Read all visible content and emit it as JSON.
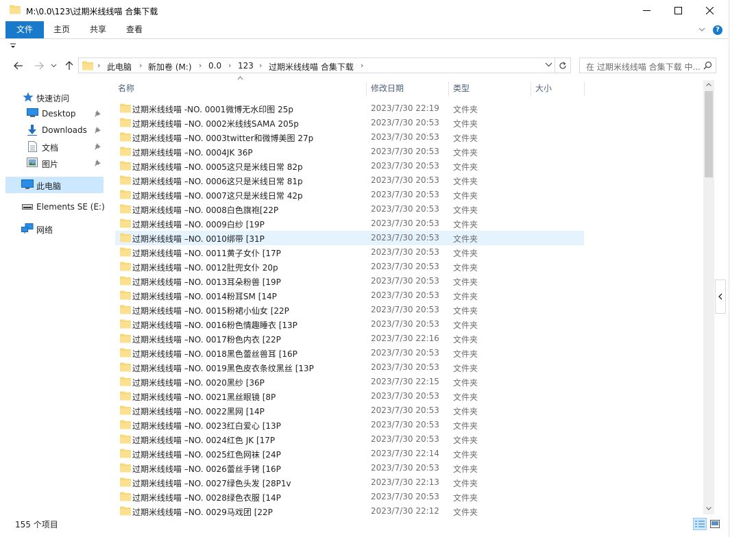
{
  "window": {
    "title": "M:\\0.0\\123\\过期米线线喵 合集下载"
  },
  "ribbon": {
    "tabs": [
      "文件",
      "主页",
      "共享",
      "查看"
    ],
    "help": "?"
  },
  "address": {
    "crumbs": [
      "此电脑",
      "新加卷 (M:)",
      "0.0",
      "123",
      "过期米线线喵 合集下载"
    ]
  },
  "search": {
    "placeholder": "在 过期米线线喵 合集下载 中..."
  },
  "nav": {
    "quick_access": "快速访问",
    "desktop": "Desktop",
    "downloads": "Downloads",
    "documents": "文档",
    "pictures": "图片",
    "this_pc": "此电脑",
    "drive": "Elements SE (E:)",
    "network": "网络"
  },
  "columns": {
    "name": "名称",
    "date": "修改日期",
    "type": "类型",
    "size": "大小"
  },
  "files": [
    {
      "name": "过期米线线喵 -NO. 0001微博无水印图 25p",
      "date": "2023/7/30 22:19",
      "type": "文件夹"
    },
    {
      "name": "过期米线线喵 –NO. 0002米线线SAMA 205p",
      "date": "2023/7/30 20:53",
      "type": "文件夹"
    },
    {
      "name": "过期米线线喵 –NO. 0003twitter和微博美图 27p",
      "date": "2023/7/30 20:53",
      "type": "文件夹"
    },
    {
      "name": "过期米线线喵 –NO. 0004JK 36P",
      "date": "2023/7/30 20:53",
      "type": "文件夹"
    },
    {
      "name": "过期米线线喵 –NO. 0005这只是米线日常 82p",
      "date": "2023/7/30 20:53",
      "type": "文件夹"
    },
    {
      "name": "过期米线线喵 –NO. 0006这只是米线日常 81p",
      "date": "2023/7/30 20:53",
      "type": "文件夹"
    },
    {
      "name": "过期米线线喵 –NO. 0007这只是米线日常 42p",
      "date": "2023/7/30 20:53",
      "type": "文件夹"
    },
    {
      "name": "过期米线线喵 –NO. 0008白色旗袍[22P",
      "date": "2023/7/30 20:53",
      "type": "文件夹"
    },
    {
      "name": "过期米线线喵 –NO. 0009白纱 [19P",
      "date": "2023/7/30 20:53",
      "type": "文件夹"
    },
    {
      "name": "过期米线线喵 –NO. 0010绑带 [31P",
      "date": "2023/7/30 20:53",
      "type": "文件夹"
    },
    {
      "name": "过期米线线喵 –NO. 0011黄子女仆 [17P",
      "date": "2023/7/30 20:53",
      "type": "文件夹"
    },
    {
      "name": "过期米线线喵 –NO. 0012肚兜女仆 20p",
      "date": "2023/7/30 20:53",
      "type": "文件夹"
    },
    {
      "name": "过期米线线喵 –NO. 0013耳朵粉兽 [19P",
      "date": "2023/7/30 20:53",
      "type": "文件夹"
    },
    {
      "name": "过期米线线喵 –NO. 0014粉耳SM [14P",
      "date": "2023/7/30 20:53",
      "type": "文件夹"
    },
    {
      "name": "过期米线线喵 –NO. 0015粉裙小仙女 [22P",
      "date": "2023/7/30 20:53",
      "type": "文件夹"
    },
    {
      "name": "过期米线线喵 –NO. 0016粉色情趣睡衣 [13P",
      "date": "2023/7/30 20:53",
      "type": "文件夹"
    },
    {
      "name": "过期米线线喵 –NO. 0017粉色内衣 [22P",
      "date": "2023/7/30 22:16",
      "type": "文件夹"
    },
    {
      "name": "过期米线线喵 –NO. 0018黑色蕾丝兽耳 [16P",
      "date": "2023/7/30 20:53",
      "type": "文件夹"
    },
    {
      "name": "过期米线线喵 –NO. 0019黑色皮衣条纹黑丝 [13P",
      "date": "2023/7/30 20:53",
      "type": "文件夹"
    },
    {
      "name": "过期米线线喵 –NO. 0020黑纱 [36P",
      "date": "2023/7/30 22:15",
      "type": "文件夹"
    },
    {
      "name": "过期米线线喵 –NO. 0021黑丝眼镜 [8P",
      "date": "2023/7/30 20:53",
      "type": "文件夹"
    },
    {
      "name": "过期米线线喵 –NO. 0022黑网 [14P",
      "date": "2023/7/30 20:53",
      "type": "文件夹"
    },
    {
      "name": "过期米线线喵 –NO. 0023红白爱心 [13P",
      "date": "2023/7/30 20:53",
      "type": "文件夹"
    },
    {
      "name": "过期米线线喵 –NO. 0024红色 JK [17P",
      "date": "2023/7/30 20:53",
      "type": "文件夹"
    },
    {
      "name": "过期米线线喵 –NO. 0025红色网袜 [24P",
      "date": "2023/7/30 22:14",
      "type": "文件夹"
    },
    {
      "name": "过期米线线喵 –NO. 0026蕾丝手铐 [16P",
      "date": "2023/7/30 20:53",
      "type": "文件夹"
    },
    {
      "name": "过期米线线喵 –NO. 0027绿色头发 [28P1v",
      "date": "2023/7/30 22:13",
      "type": "文件夹"
    },
    {
      "name": "过期米线线喵 –NO. 0028绿色衣服 [14P",
      "date": "2023/7/30 20:53",
      "type": "文件夹"
    },
    {
      "name": "过期米线线喵 –NO. 0029马戏团 [22P",
      "date": "2023/7/30 22:12",
      "type": "文件夹"
    }
  ],
  "status": {
    "item_count": "155 个项目"
  },
  "colors": {
    "accent": "#1979ca",
    "selection": "#cce8ff",
    "hover": "#e5f3ff",
    "folder": "#f8d775"
  }
}
